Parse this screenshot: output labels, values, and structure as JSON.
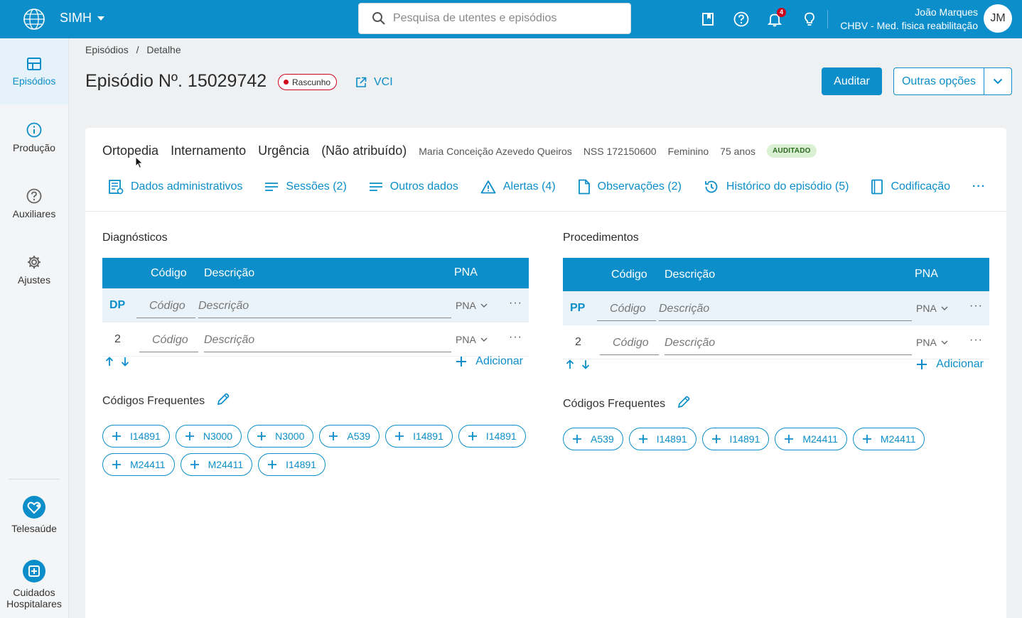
{
  "topbar": {
    "app_name": "SIMH",
    "search_placeholder": "Pesquisa de utentes e episódios",
    "notification_count": "4",
    "user_name": "João Marques",
    "user_unit": "CHBV - Med. fisica reabilitação",
    "avatar_initials": "JM",
    "icons": [
      "globe-logo-icon",
      "book-icon",
      "help-icon",
      "bell-icon",
      "lightbulb-icon"
    ]
  },
  "sidebar": {
    "items": [
      {
        "label": "Episódios",
        "icon": "table-icon",
        "active": true
      },
      {
        "label": "Produção",
        "icon": "info-icon"
      },
      {
        "label": "Auxiliares",
        "icon": "help-icon"
      },
      {
        "label": "Ajustes",
        "icon": "gear-icon"
      },
      {
        "label": "Telesaúde",
        "icon": "heart-plus-icon"
      },
      {
        "label": "Cuidados Hospitalares",
        "icon": "hospital-plus-icon"
      }
    ]
  },
  "breadcrumb": {
    "parent": "Episódios",
    "separator": "/",
    "current": "Detalhe"
  },
  "header": {
    "title": "Episódio Nº. 15029742",
    "draft_label": "Rascunho",
    "vci_label": "VCI",
    "audit_button": "Auditar",
    "other_options": "Outras opções"
  },
  "episode": {
    "specialty": "Ortopedia",
    "type": "Internamento",
    "origin": "Urgência",
    "assignment": "(Não atribuído)",
    "patient_name": "Maria Conceição Azevedo Queiros",
    "nss": "NSS 172150600",
    "sex": "Feminino",
    "age": "75 anos",
    "status": "AUDITADO"
  },
  "tabs": [
    {
      "label": "Dados administrativos",
      "icon": "form-icon"
    },
    {
      "label": "Sessões (2)",
      "icon": "lines-icon"
    },
    {
      "label": "Outros dados",
      "icon": "lines-icon"
    },
    {
      "label": "Alertas (4)",
      "icon": "warning-icon"
    },
    {
      "label": "Observações (2)",
      "icon": "document-icon"
    },
    {
      "label": "Histórico do episódio (5)",
      "icon": "history-icon"
    },
    {
      "label": "Codificação",
      "icon": "book-icon"
    }
  ],
  "tabs_more": "···",
  "diagnosticos": {
    "title": "Diagnósticos",
    "col_code": "Código",
    "col_desc": "Descrição",
    "col_pna": "PNA",
    "rows": [
      {
        "label": "DP",
        "code_placeholder": "Código",
        "desc_placeholder": "Descrição",
        "pna": "PNA"
      },
      {
        "label": "2",
        "code_placeholder": "Código",
        "desc_placeholder": "Descrição",
        "pna": "PNA"
      }
    ],
    "add_label": "Adicionar",
    "freq_title": "Códigos Frequentes",
    "freq_codes": [
      "I14891",
      "N3000",
      "N3000",
      "A539",
      "I14891",
      "I14891",
      "M24411",
      "M24411",
      "I14891"
    ]
  },
  "procedimentos": {
    "title": "Procedimentos",
    "col_code": "Código",
    "col_desc": "Descrição",
    "col_pna": "PNA",
    "rows": [
      {
        "label": "PP",
        "code_placeholder": "Código",
        "desc_placeholder": "Descrição",
        "pna": "PNA"
      },
      {
        "label": "2",
        "code_placeholder": "Código",
        "desc_placeholder": "Descrição",
        "pna": "PNA"
      }
    ],
    "add_label": "Adicionar",
    "freq_title": "Códigos Frequentes",
    "freq_codes": [
      "A539",
      "I14891",
      "I14891",
      "M24411",
      "M24411"
    ]
  },
  "colors": {
    "primary": "#0b8ec9",
    "danger": "#d0021b",
    "success_bg": "#d9f0d3"
  }
}
